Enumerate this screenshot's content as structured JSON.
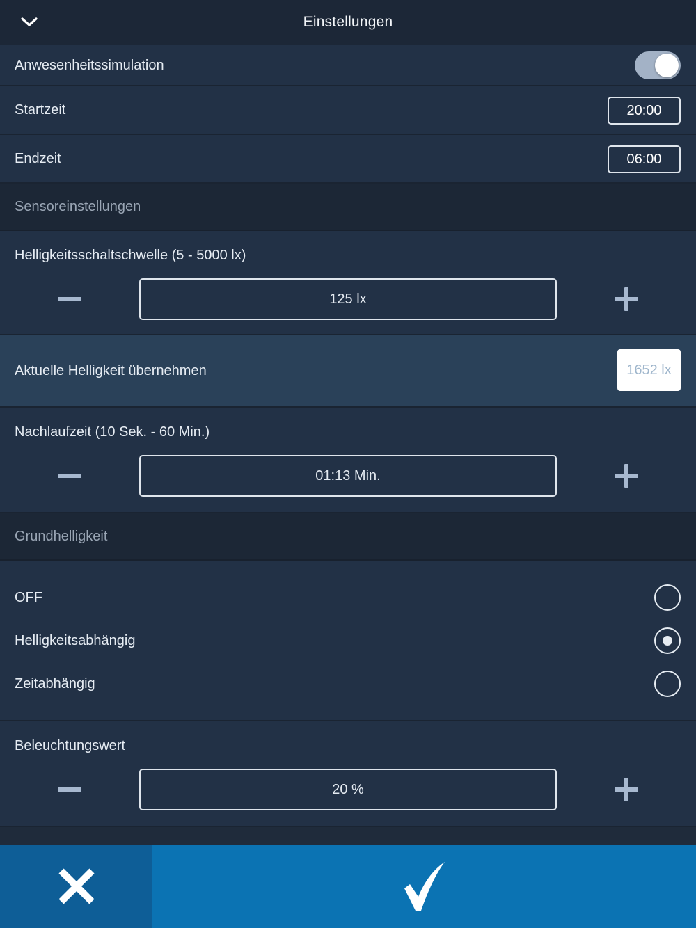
{
  "header": {
    "title": "Einstellungen",
    "back_icon": "chevron-down-icon"
  },
  "presence_simulation": {
    "label": "Anwesenheitssimulation",
    "enabled": true
  },
  "start_time": {
    "label": "Startzeit",
    "value": "20:00"
  },
  "end_time": {
    "label": "Endzeit",
    "value": "06:00"
  },
  "sensor_section": {
    "title": "Sensoreinstellungen"
  },
  "brightness_threshold": {
    "label": "Helligkeitsschaltschwelle (5 - 5000 lx)",
    "value": "125 lx"
  },
  "current_brightness": {
    "label": "Aktuelle Helligkeit übernehmen",
    "value": "1652 lx"
  },
  "follow_up_time": {
    "label": "Nachlaufzeit (10 Sek. - 60 Min.)",
    "value": "01:13 Min."
  },
  "base_brightness_section": {
    "title": "Grundhelligkeit"
  },
  "base_brightness_options": [
    {
      "label": "OFF",
      "selected": false
    },
    {
      "label": "Helligkeitsabhängig",
      "selected": true
    },
    {
      "label": "Zeitabhängig",
      "selected": false
    }
  ],
  "lighting_value": {
    "label": "Beleuchtungswert",
    "value": "20 %"
  },
  "bottom_bar": {
    "cancel_icon": "close-icon",
    "confirm_icon": "checkmark-icon"
  },
  "colors": {
    "background": "#1f2b3b",
    "row": "#223146",
    "highlight_row": "#2a4159",
    "cancel": "#0e5e97",
    "confirm": "#0b73b3"
  }
}
